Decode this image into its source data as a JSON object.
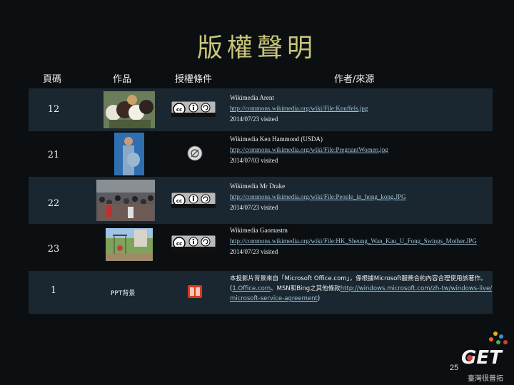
{
  "title": "版權聲明",
  "headers": {
    "page": "頁碼",
    "work": "作品",
    "license": "授權條件",
    "author": "作者/來源"
  },
  "rows": [
    {
      "page": "12",
      "line1": "Wikimedia Arent",
      "link": "http://commons.wikimedia.org/wiki/File:Knuffels.jpg",
      "line3": "2014/07/23 visited",
      "license_icon": "cc-by-sa-icon"
    },
    {
      "page": "21",
      "line1": "Wikimedia Ken Hammond (USDA)",
      "link": "http://commons.wikimedia.org/wiki/File:PregnantWomen.jpg",
      "line3": "2014/07/03 visited",
      "license_icon": "public-domain-icon"
    },
    {
      "page": "22",
      "line1": "Wikimedia Mr Drake",
      "link": "http://commons.wikimedia.org/wiki/File:People_in_hong_kong.JPG",
      "line3": "2014/07/23 visited",
      "license_icon": "cc-by-sa-icon"
    },
    {
      "page": "23",
      "line1": "Wikimedia Gaomastm",
      "link": "http://commons.wikimedia.org/wiki/File:HK_Sheung_Wan_Kau_U_Fong_Swings_Mother.JPG",
      "line3": "2014/07/23 visited",
      "license_icon": "cc-by-sa-icon"
    },
    {
      "page": "1",
      "work_label": "PPT背景",
      "text_a": "本投影片背景來自「Microsoft Office.com」，係根據Microsoft服務合約內容合理使用該著作。(",
      "link_a": "1.Office.com",
      "text_b": "、MSN和Bing之其他條款",
      "link_b": "http://windows.microsoft.com/zh-tw/windows-live/microsoft-service-agreement",
      "text_c": ")",
      "license_icon": "ms-office-icon"
    }
  ],
  "footer": {
    "page_number": "25",
    "logo_text": "臺灣很普拓"
  }
}
